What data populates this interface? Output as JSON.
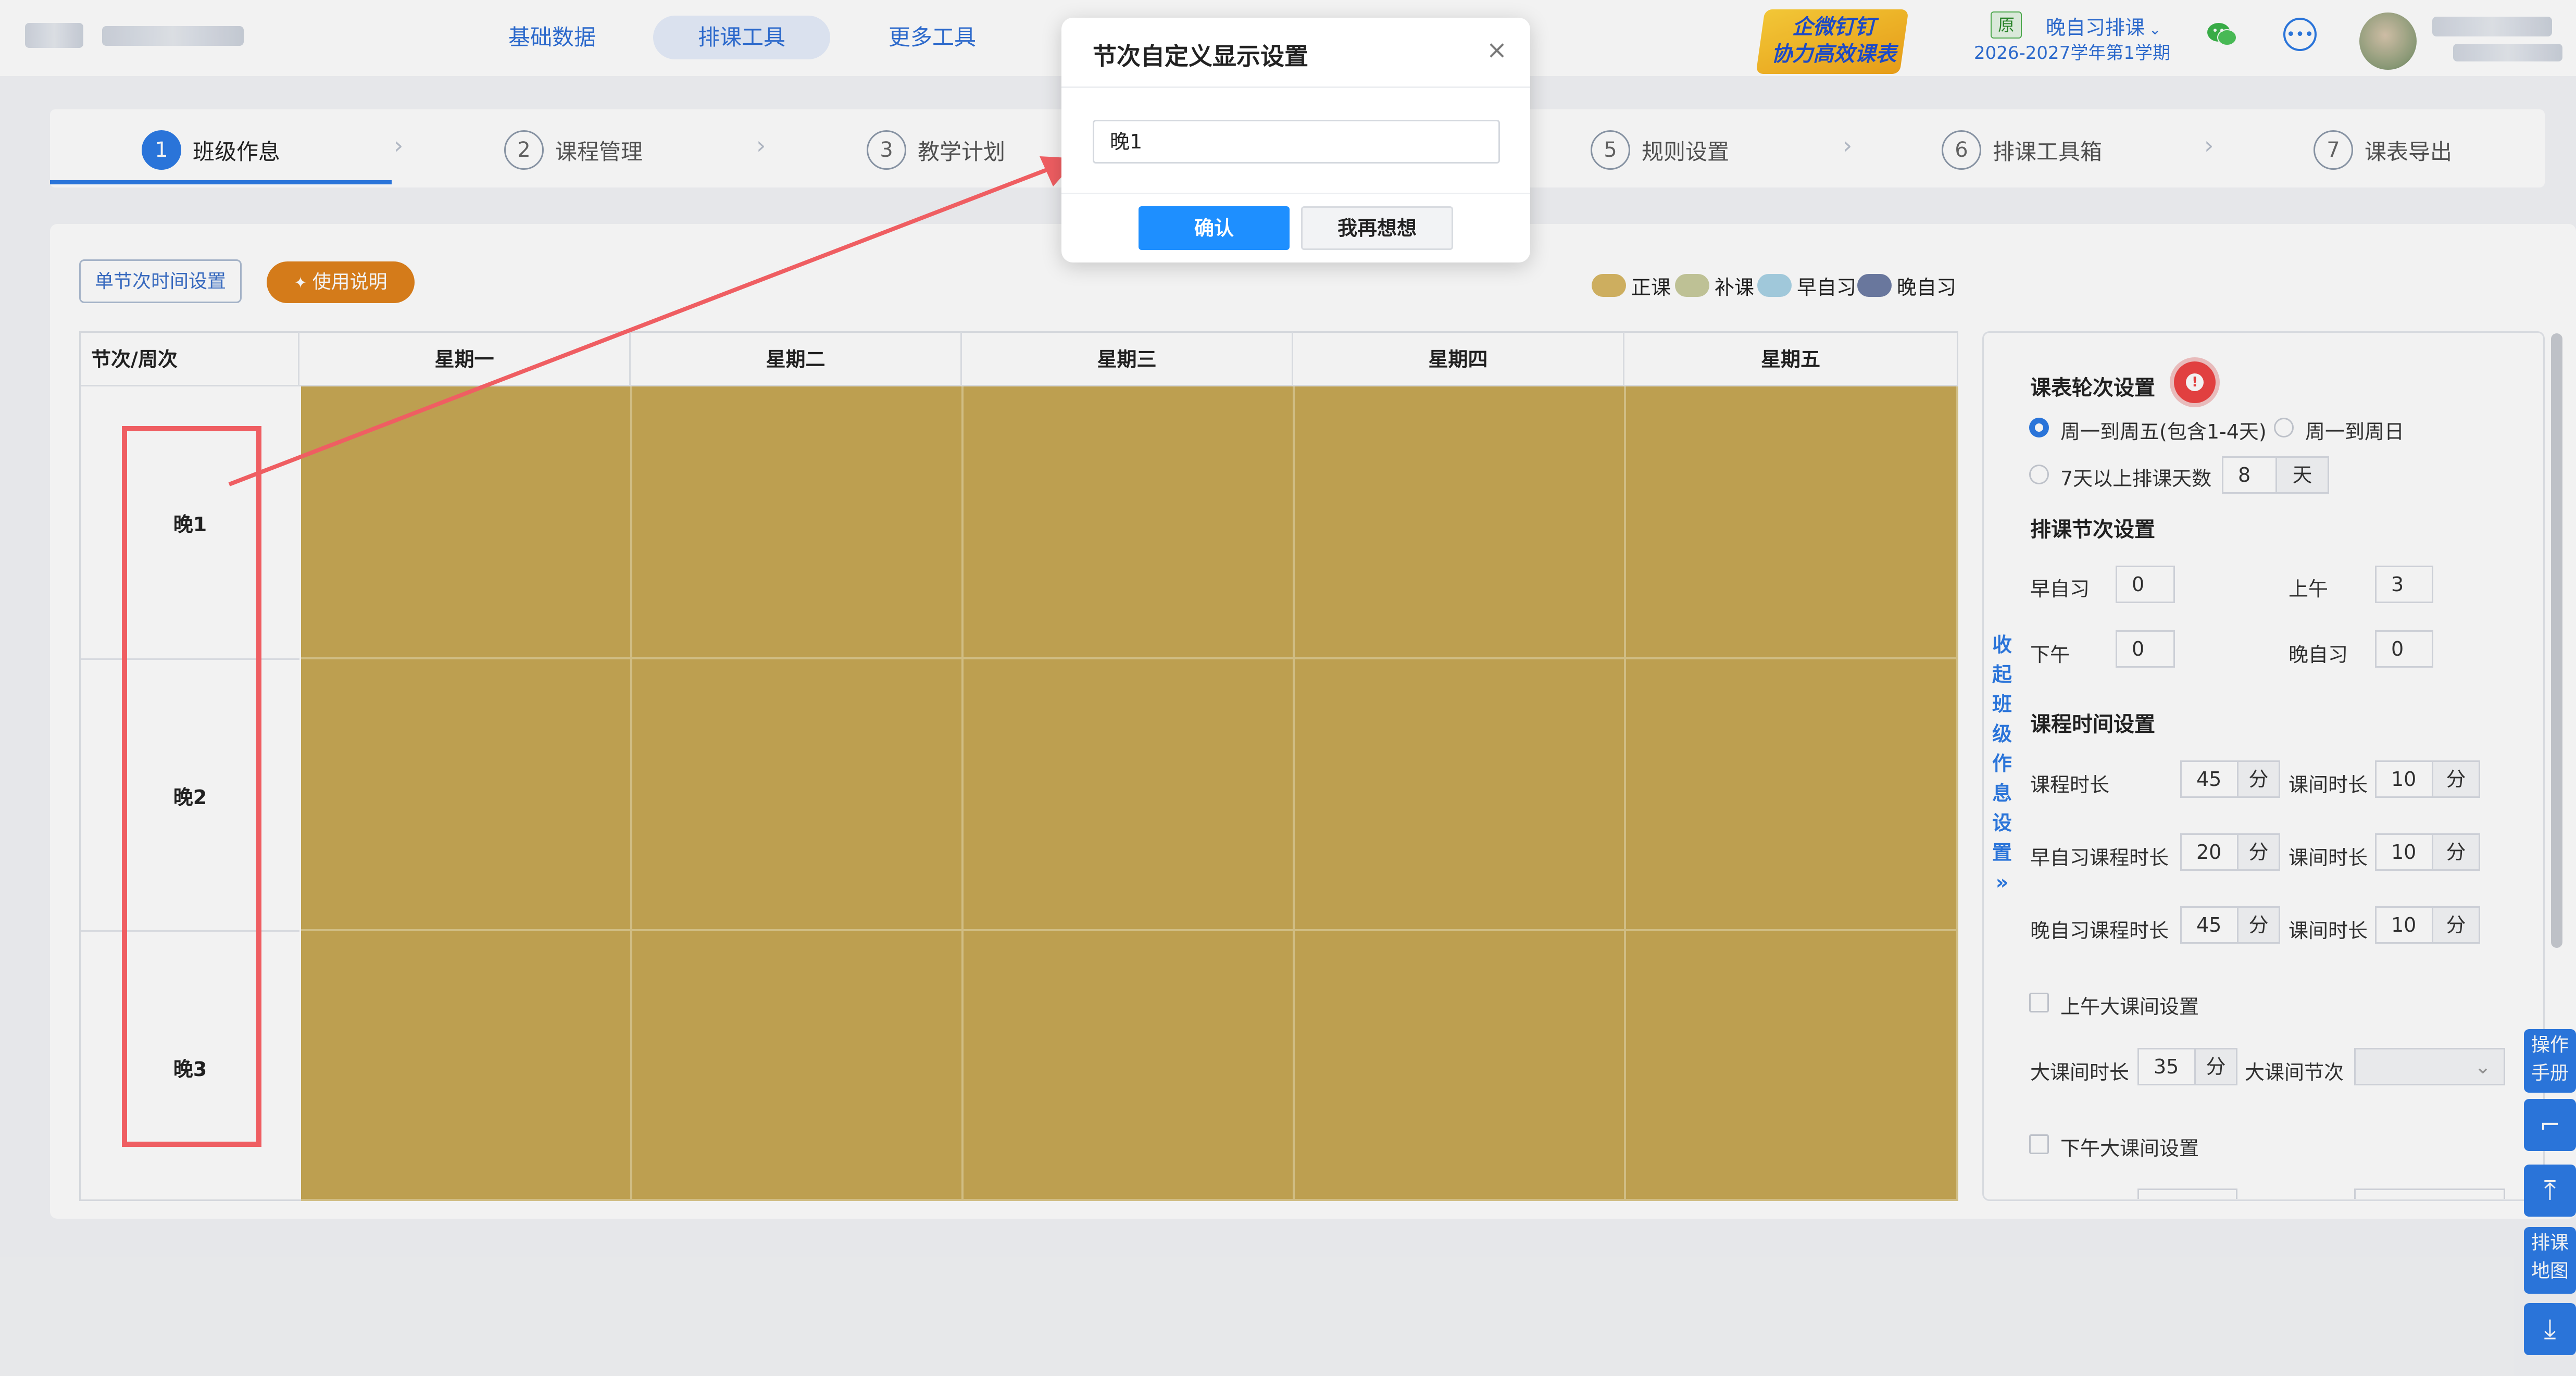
{
  "header": {
    "nav": [
      "基础数据",
      "排课工具",
      "更多工具"
    ],
    "active_nav": "排课工具",
    "brand_line1": "企微钉钉",
    "brand_line2": "协力高效课表",
    "term_tag": "原",
    "term_name": "晚自习排课",
    "term_year": "2026-2027学年第1学期"
  },
  "steps": [
    {
      "num": "1",
      "label": "班级作息"
    },
    {
      "num": "2",
      "label": "课程管理"
    },
    {
      "num": "3",
      "label": "教学计划"
    },
    {
      "num": "5",
      "label": "规则设置"
    },
    {
      "num": "6",
      "label": "排课工具箱"
    },
    {
      "num": "7",
      "label": "课表导出"
    }
  ],
  "toolbar": {
    "time_settings": "单节次时间设置",
    "usage_guide": "使用说明"
  },
  "legend": [
    {
      "label": "正课",
      "color": "#d8b865"
    },
    {
      "label": "补课",
      "color": "#c9cc9e"
    },
    {
      "label": "早自习",
      "color": "#a9d3e6"
    },
    {
      "label": "晚自习",
      "color": "#6f7ea6"
    }
  ],
  "timetable": {
    "corner": "节次/周次",
    "days": [
      "星期一",
      "星期二",
      "星期三",
      "星期四",
      "星期五"
    ],
    "periods": [
      "晚1",
      "晚2",
      "晚3"
    ],
    "cell_color": "#c8a855"
  },
  "panel": {
    "rotation_title": "课表轮次设置",
    "option_mon_fri": "周一到周五(包含1-4天)",
    "option_mon_sun": "周一到周日",
    "option_7plus": "7天以上排课天数",
    "days_value": "8",
    "days_unit": "天",
    "period_title": "排课节次设置",
    "morning_study_label": "早自习",
    "morning_study_value": "0",
    "am_label": "上午",
    "am_value": "3",
    "pm_label": "下午",
    "pm_value": "0",
    "evening_study_label": "晚自习",
    "evening_study_value": "0",
    "time_title": "课程时间设置",
    "course_len_label": "课程时长",
    "course_len_value": "45",
    "break_label": "课间时长",
    "break_value": "10",
    "morning_len_label": "早自习课程时长",
    "morning_len_value": "20",
    "morning_break_value": "10",
    "evening_len_label": "晚自习课程时长",
    "evening_len_value": "45",
    "evening_break_value": "10",
    "unit_min": "分",
    "am_big_break": "上午大课间设置",
    "big_break_len_label": "大课间时长",
    "big_break_len_value": "35",
    "big_break_period_label": "大课间节次",
    "pm_big_break": "下午大课间设置",
    "collapse_label": "收起班级作息设置"
  },
  "side_buttons": {
    "manual": "操作手册",
    "map": "排课地图"
  },
  "modal": {
    "title": "节次自定义显示设置",
    "input_value": "晚1",
    "confirm": "确认",
    "cancel": "我再想想"
  }
}
